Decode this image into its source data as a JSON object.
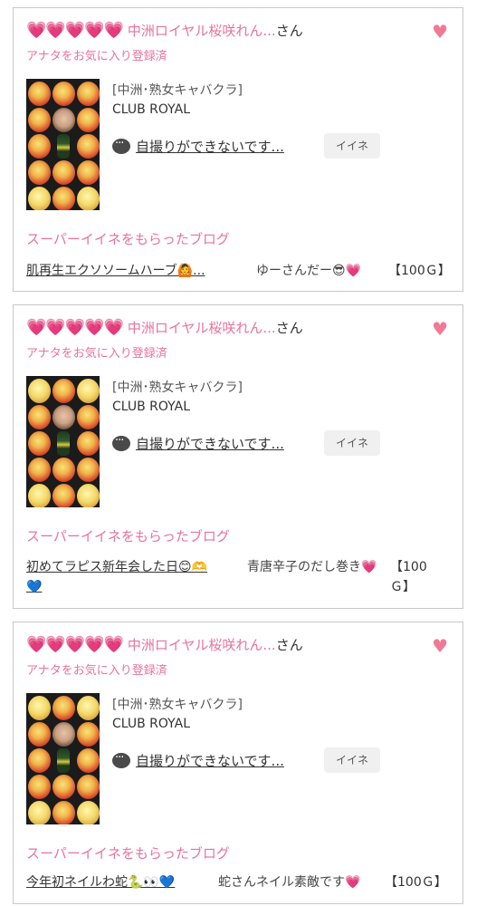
{
  "cards": [
    {
      "hearts": "💗💗💗💗💗",
      "name": "中洲ロイヤル桜咲れん...",
      "honorific": "さん",
      "fav_status": "アナタをお気に入り登録済",
      "shop_category": "[中洲･熟女キャバクラ]",
      "shop_name": "CLUB ROYAL",
      "comment": "自撮りができないです...",
      "iine_label": "イイネ",
      "super_label": "スーパーイイネをもらったブログ",
      "blog_title": "肌再生エクソソームハーブ🙆...",
      "from_user": "ゆーさんだー😎💗",
      "points": "【100Ｇ】"
    },
    {
      "hearts": "💗💗💗💗💗",
      "name": "中洲ロイヤル桜咲れん...",
      "honorific": "さん",
      "fav_status": "アナタをお気に入り登録済",
      "shop_category": "[中洲･熟女キャバクラ]",
      "shop_name": "CLUB ROYAL",
      "comment": "自撮りができないです...",
      "iine_label": "イイネ",
      "super_label": "スーパーイイネをもらったブログ",
      "blog_title": "初めてラピス新年会した日😊🫶💙",
      "from_user": "青唐辛子のだし巻き💗",
      "points": "【100Ｇ】"
    },
    {
      "hearts": "💗💗💗💗💗",
      "name": "中洲ロイヤル桜咲れん...",
      "honorific": "さん",
      "fav_status": "アナタをお気に入り登録済",
      "shop_category": "[中洲･熟女キャバクラ]",
      "shop_name": "CLUB ROYAL",
      "comment": "自撮りができないです...",
      "iine_label": "イイネ",
      "super_label": "スーパーイイネをもらったブログ",
      "blog_title": "今年初ネイルわ蛇🐍👀💙",
      "from_user": "蛇さんネイル素敵です💗",
      "points": "【100Ｇ】"
    }
  ]
}
